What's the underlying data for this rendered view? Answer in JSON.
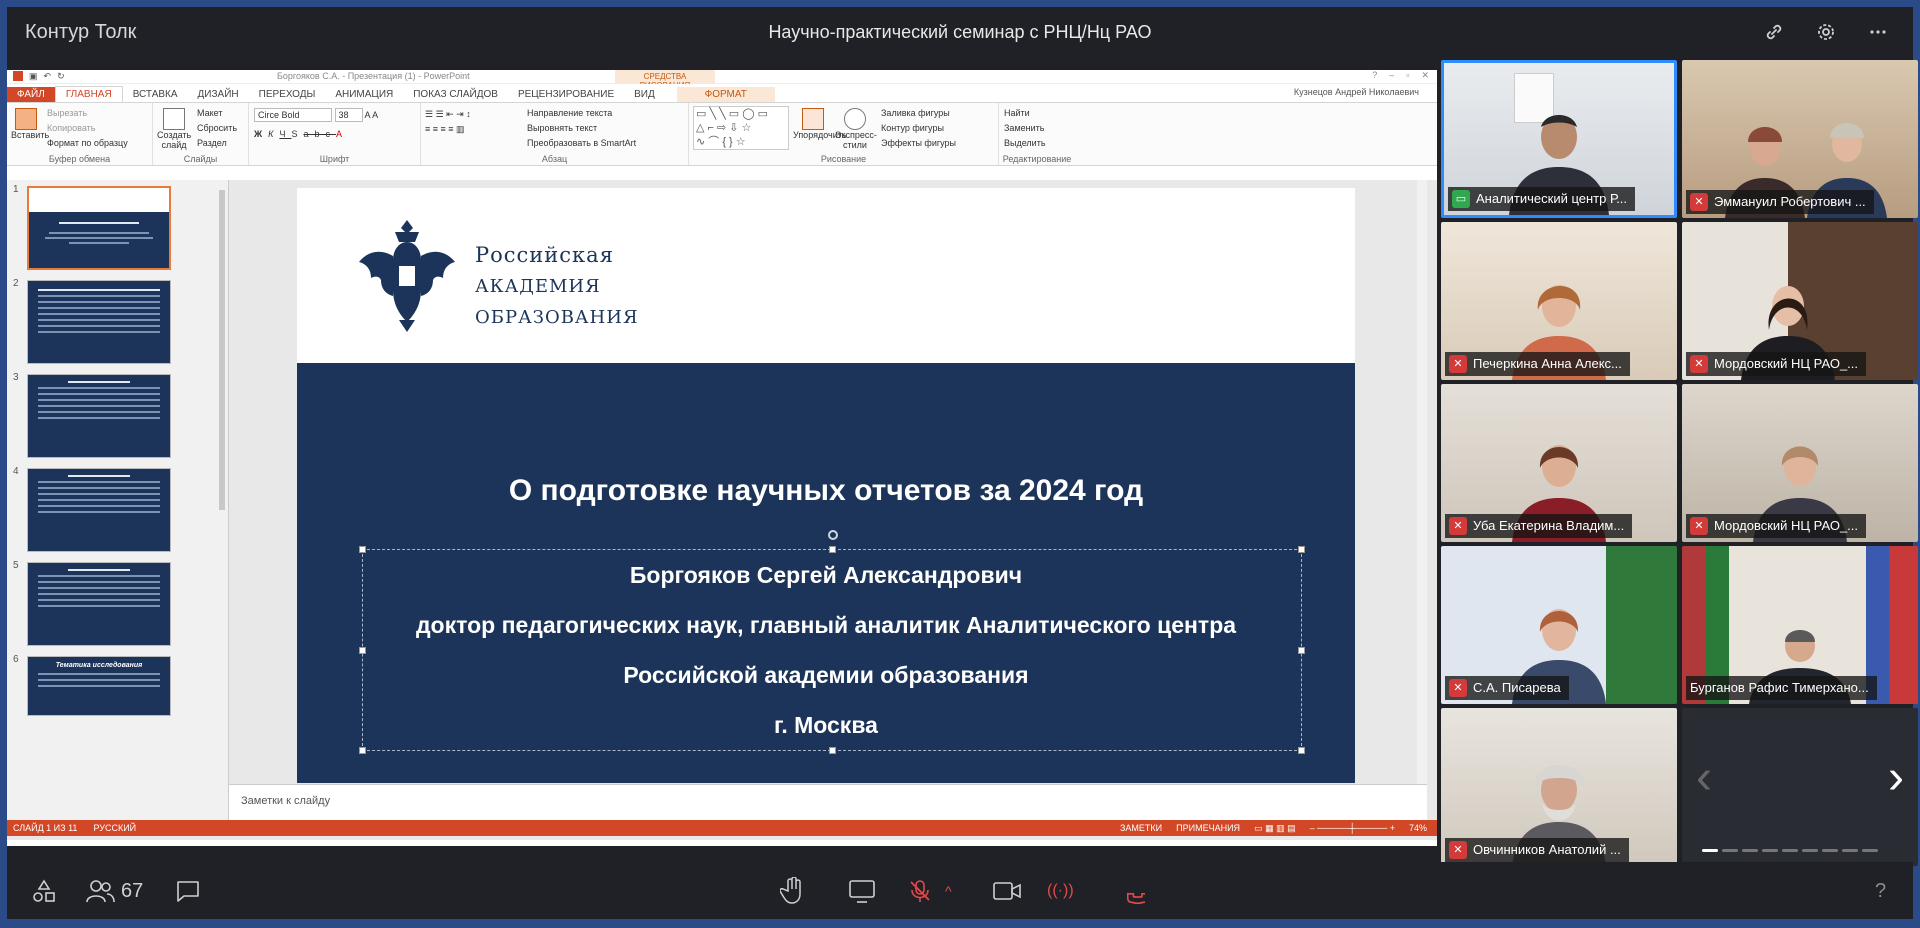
{
  "app": {
    "name": "Контур Толк",
    "meeting_title": "Научно-практический семинар с РНЦ/Нц РАО"
  },
  "top_icons": [
    "link-icon",
    "gear-icon",
    "more-icon"
  ],
  "powerpoint": {
    "doc_title": "Боргояков С.А. - Презентация (1) - PowerPoint",
    "context_header": "СРЕДСТВА РИСОВАНИЯ",
    "user": "Кузнецов Андрей Николаевич",
    "tabs": [
      "ФАЙЛ",
      "ГЛАВНАЯ",
      "ВСТАВКА",
      "ДИЗАЙН",
      "ПЕРЕХОДЫ",
      "АНИМАЦИЯ",
      "ПОКАЗ СЛАЙДОВ",
      "РЕЦЕНЗИРОВАНИЕ",
      "ВИД",
      "ФОРМАТ"
    ],
    "ribbon": {
      "clipboard": {
        "label": "Буфер обмена",
        "paste": "Вставить",
        "cut": "Вырезать",
        "copy": "Копировать",
        "format_painter": "Формат по образцу"
      },
      "slides": {
        "label": "Слайды",
        "new_slide": "Создать слайд",
        "layout": "Макет",
        "reset": "Сбросить",
        "section": "Раздел"
      },
      "font": {
        "label": "Шрифт",
        "font_name": "Circe Bold",
        "font_size": "38"
      },
      "paragraph": {
        "label": "Абзац",
        "text_direction": "Направление текста",
        "align_text": "Выровнять текст",
        "smartart": "Преобразовать в SmartArt"
      },
      "drawing": {
        "label": "Рисование",
        "arrange": "Упорядочить",
        "quick_styles": "Экспресс-стили",
        "fill": "Заливка фигуры",
        "outline": "Контур фигуры",
        "effects": "Эффекты фигуры"
      },
      "editing": {
        "label": "Редактирование",
        "find": "Найти",
        "replace": "Заменить",
        "select": "Выделить"
      }
    },
    "slide": {
      "academy": [
        "Российская",
        "академия",
        "образования"
      ],
      "title": "О подготовке научных отчетов за 2024 год",
      "lines": [
        "Боргояков Сергей Александрович",
        "доктор педагогических наук, главный аналитик Аналитического центра",
        "Российской академии образования",
        "г. Москва"
      ]
    },
    "thumbnails": [
      "1",
      "2",
      "3",
      "4",
      "5",
      "6"
    ],
    "thumb6_text": "Тематика исследования",
    "notes_placeholder": "Заметки к слайду",
    "status": {
      "slide": "СЛАЙД 1 ИЗ 11",
      "lang": "РУССКИЙ",
      "notes": "ЗАМЕТКИ",
      "comments": "ПРИМЕЧАНИЯ",
      "zoom": "74%"
    }
  },
  "participants": [
    {
      "name": "Аналитический центр Р...",
      "status": "screen"
    },
    {
      "name": "Эммануил Робертович ...",
      "status": "muted"
    },
    {
      "name": "Печеркина Анна Алекс...",
      "status": "muted"
    },
    {
      "name": "Мордовский НЦ РАО_...",
      "status": "muted"
    },
    {
      "name": "Уба Екатерина Владим...",
      "status": "muted"
    },
    {
      "name": "Мордовский НЦ РАО_...",
      "status": "muted"
    },
    {
      "name": "С.А. Писарева",
      "status": "muted"
    },
    {
      "name": "Бурганов Рафис Тимерхано...",
      "status": "none"
    },
    {
      "name": "Овчинников Анатолий ...",
      "status": "muted"
    }
  ],
  "bottom": {
    "participants_count": "67",
    "help": "?"
  },
  "colors": {
    "accent": "#2f8cff",
    "pp_orange": "#d24726",
    "slide_blue": "#1c3459",
    "muted_red": "#d33a3a"
  }
}
